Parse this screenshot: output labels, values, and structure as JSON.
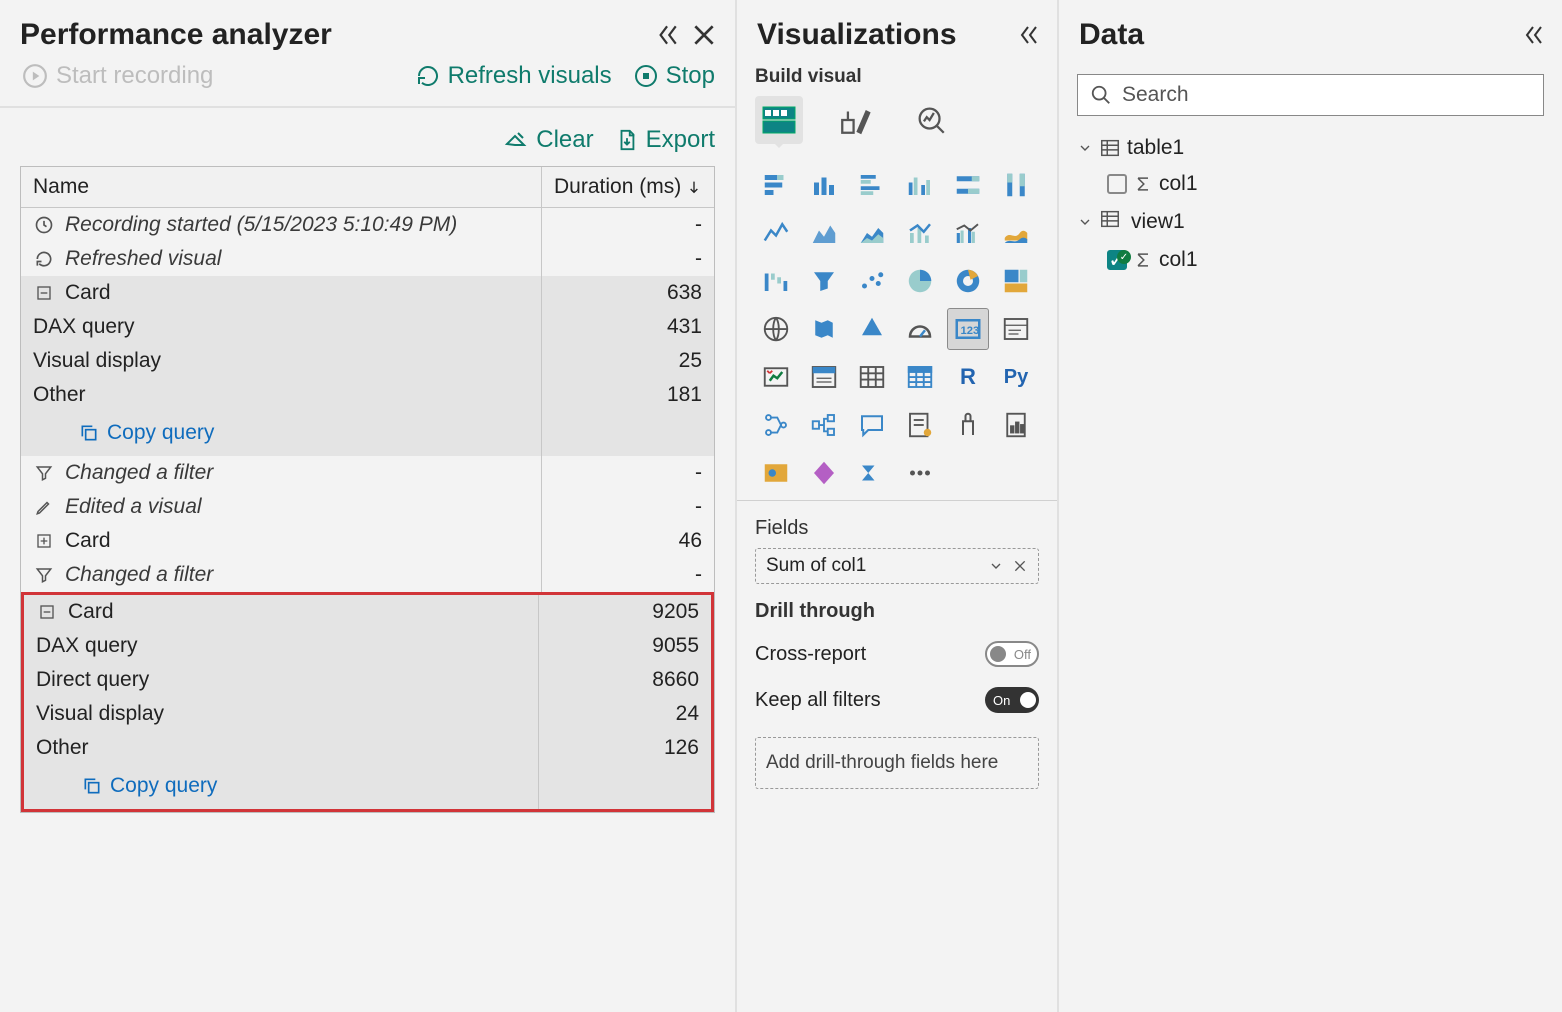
{
  "perf": {
    "title": "Performance analyzer",
    "start_recording": "Start recording",
    "refresh": "Refresh visuals",
    "stop": "Stop",
    "clear": "Clear",
    "export": "Export",
    "col_name": "Name",
    "col_duration": "Duration (ms)",
    "recording_started": "Recording started (5/15/2023 5:10:49 PM)",
    "refreshed_visual": "Refreshed visual",
    "card1": {
      "label": "Card",
      "total": "638",
      "dax": "DAX query",
      "dax_v": "431",
      "vis": "Visual display",
      "vis_v": "25",
      "oth": "Other",
      "oth_v": "181",
      "copy": "Copy query"
    },
    "changed_filter": "Changed a filter",
    "edited_visual": "Edited a visual",
    "card2": {
      "label": "Card",
      "total": "46"
    },
    "changed_filter2": "Changed a filter",
    "card3": {
      "label": "Card",
      "total": "9205",
      "dax": "DAX query",
      "dax_v": "9055",
      "dq": "Direct query",
      "dq_v": "8660",
      "vis": "Visual display",
      "vis_v": "24",
      "oth": "Other",
      "oth_v": "126",
      "copy": "Copy query"
    }
  },
  "viz": {
    "title": "Visualizations",
    "subtitle": "Build visual",
    "fields": "Fields",
    "field_value": "Sum of col1",
    "drill": "Drill through",
    "cross": "Cross-report",
    "cross_toggle": "Off",
    "keep": "Keep all filters",
    "keep_toggle": "On",
    "drop": "Add drill-through fields here"
  },
  "data": {
    "title": "Data",
    "search_placeholder": "Search",
    "table1": "table1",
    "table1_col": "col1",
    "view1": "view1",
    "view1_col": "col1"
  }
}
